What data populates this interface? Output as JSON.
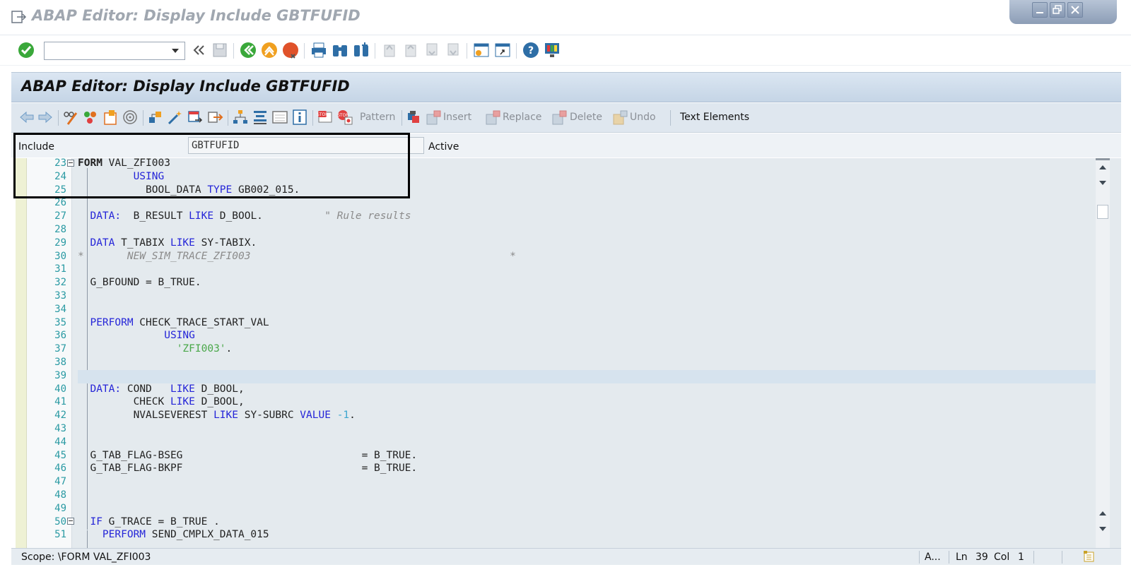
{
  "window": {
    "title": "ABAP Editor: Display Include GBTFUFID"
  },
  "screen": {
    "header": "ABAP Editor: Display Include GBTFUFID"
  },
  "command_field": {
    "value": ""
  },
  "app_toolbar": {
    "pattern": "Pattern",
    "insert": "Insert",
    "replace": "Replace",
    "delete": "Delete",
    "undo": "Undo",
    "text_elements": "Text Elements"
  },
  "include_row": {
    "label": "Include",
    "value": "GBTFUFID",
    "status": "Active"
  },
  "editor": {
    "lines": [
      {
        "n": "23",
        "html": "<span class=\"bold\">FORM</span> VAL_ZFI003"
      },
      {
        "n": "24",
        "html": "         <span class=\"kw\">USING</span>"
      },
      {
        "n": "25",
        "html": "           BOOL_DATA <span class=\"kw\">TYPE</span> GB002_015."
      },
      {
        "n": "26",
        "html": ""
      },
      {
        "n": "27",
        "html": "  <span class=\"kw\">DATA:</span>  B_RESULT <span class=\"kw\">LIKE</span> D_BOOL.          <span class=\"cm\">\" Rule results</span>"
      },
      {
        "n": "28",
        "html": ""
      },
      {
        "n": "29",
        "html": "  <span class=\"kw\">DATA</span> T_TABIX <span class=\"kw\">LIKE</span> SY-TABIX."
      },
      {
        "n": "30",
        "html": "<span class=\"cm\">*       NEW_SIM_TRACE_ZFI003                                          *</span>"
      },
      {
        "n": "31",
        "html": ""
      },
      {
        "n": "32",
        "html": "  G_BFOUND = B_TRUE."
      },
      {
        "n": "33",
        "html": ""
      },
      {
        "n": "34",
        "html": ""
      },
      {
        "n": "35",
        "html": "  <span class=\"kw\">PERFORM</span> CHECK_TRACE_START_VAL"
      },
      {
        "n": "36",
        "html": "              <span class=\"kw\">USING</span>"
      },
      {
        "n": "37",
        "html": "                <span class=\"st\">'ZFI003'</span>."
      },
      {
        "n": "38",
        "html": ""
      },
      {
        "n": "39",
        "html": ""
      },
      {
        "n": "40",
        "html": "  <span class=\"kw\">DATA:</span> COND   <span class=\"kw\">LIKE</span> D_BOOL,"
      },
      {
        "n": "41",
        "html": "         CHECK <span class=\"kw\">LIKE</span> D_BOOL,"
      },
      {
        "n": "42",
        "html": "         NVALSEVEREST <span class=\"kw\">LIKE</span> SY-SUBRC <span class=\"kw\">VALUE</span> <span class=\"nm\">-1</span>."
      },
      {
        "n": "43",
        "html": ""
      },
      {
        "n": "44",
        "html": ""
      },
      {
        "n": "45",
        "html": "  G_TAB_FLAG-BSEG                             = B_TRUE."
      },
      {
        "n": "46",
        "html": "  G_TAB_FLAG-BKPF                             = B_TRUE."
      },
      {
        "n": "47",
        "html": ""
      },
      {
        "n": "48",
        "html": ""
      },
      {
        "n": "49",
        "html": ""
      },
      {
        "n": "50",
        "html": "  <span class=\"kw\">IF</span> G_TRACE = B_TRUE ."
      },
      {
        "n": "51",
        "html": "    <span class=\"kw\">PERFORM</span> SEND_CMPLX_DATA_015"
      }
    ]
  },
  "status_bar": {
    "scope": "Scope: \\FORM VAL_ZFI003",
    "mode": "A...",
    "ln_label": "Ln",
    "ln_value": "39",
    "col_label": "Col",
    "col_value": "1"
  },
  "colors": {
    "keyword": "#2525d8",
    "comment": "#8b8b8b",
    "string": "#4aa84a",
    "line_number": "#2a9aa3"
  }
}
